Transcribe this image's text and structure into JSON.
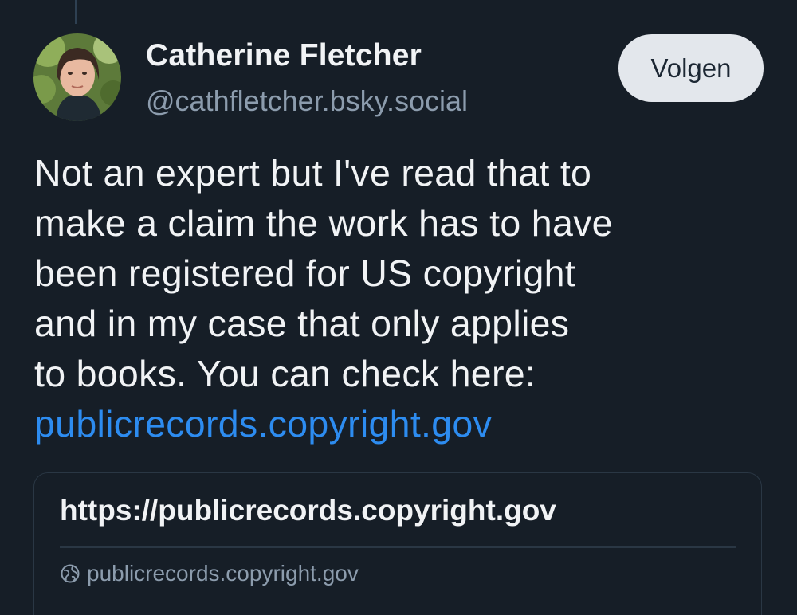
{
  "author": {
    "name": "Catherine Fletcher",
    "handle": "@cathfletcher.bsky.social",
    "avatar_icon": "profile-photo"
  },
  "follow_button": {
    "label": "Volgen"
  },
  "post": {
    "text_lines": [
      "Not an expert but I've read that to",
      "make a claim the work has to have",
      "been registered for US copyright",
      "and in my case that only applies",
      "to books. You can check here:"
    ],
    "link_text": "publicrecords.copyright.gov"
  },
  "link_card": {
    "title": "https://publicrecords.copyright.gov",
    "domain": "publicrecords.copyright.gov",
    "domain_icon": "globe-icon"
  },
  "colors": {
    "background": "#161e27",
    "link": "#2d8cf0",
    "secondary_text": "#8c9cad",
    "button_bg": "#e3e7ec"
  }
}
